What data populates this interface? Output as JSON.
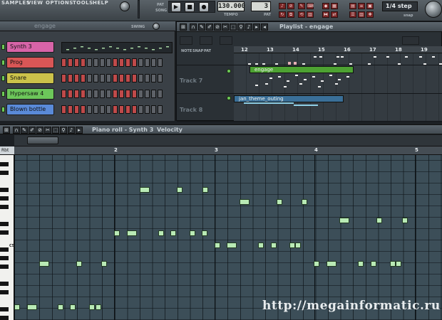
{
  "menu": [
    "SAMPLES",
    "VIEW",
    "OPTIONS",
    "TOOLS",
    "HELP"
  ],
  "toolbar": {
    "tempo": "130.000",
    "tempo_label": "TEMPO",
    "pattern_num": "3",
    "pattern_label": "PAT",
    "mode_pat": "PAT",
    "mode_song": "SONG",
    "snap": "1/4 step",
    "snap_sub": "snap",
    "icons": [
      "play-icon",
      "stop-icon",
      "record-icon"
    ]
  },
  "channel_rack": {
    "header": "engage",
    "swing_label": "SWING",
    "channels": [
      {
        "name": "Synth 3",
        "color": "#d864a8",
        "steps": null
      },
      {
        "name": "Prog",
        "color": "#d85656",
        "steps": [
          0,
          0,
          0,
          0,
          0,
          0,
          0,
          0,
          0,
          0,
          0,
          0,
          0,
          0,
          0,
          0
        ]
      },
      {
        "name": "Snare",
        "color": "#cbc24a",
        "steps": [
          0,
          0,
          0,
          0,
          0,
          0,
          0,
          0,
          0,
          0,
          0,
          0,
          0,
          0,
          0,
          0
        ]
      },
      {
        "name": "Hypersaw 4",
        "color": "#6cc65a",
        "steps": [
          0,
          0,
          0,
          0,
          0,
          0,
          0,
          0,
          0,
          0,
          0,
          0,
          0,
          0,
          0,
          0
        ]
      },
      {
        "name": "Blown bottle",
        "color": "#5a8ad8",
        "steps": [
          0,
          0,
          0,
          0,
          0,
          0,
          0,
          0,
          0,
          0,
          0,
          0,
          0,
          0,
          0,
          0
        ]
      }
    ]
  },
  "playlist": {
    "title": "Playlist - engage",
    "bars": [
      "12",
      "13",
      "14",
      "15",
      "16",
      "17",
      "18",
      "19"
    ],
    "tabs": [
      "NOTE",
      "SNAP",
      "PAT"
    ],
    "tracks": [
      {
        "name": "Track 7",
        "clip": "engage",
        "clip_color": "#4da232"
      },
      {
        "name": "Track 8",
        "clip": "jan_theme_outing",
        "clip_color": "#3a6f98"
      }
    ]
  },
  "piano_roll": {
    "title": "Piano roll - Synth 3",
    "param": "Velocity",
    "bars": [
      "2",
      "3",
      "4",
      "5"
    ],
    "c_label": "C5",
    "keyhead": "Rbt"
  },
  "watermark": "http://megainformatic.ru",
  "colors": {
    "note_fill": "#b9eab5",
    "grid_bg": "#3c4e58",
    "clip_green": "#4da232",
    "clip_blue": "#3a6f98"
  }
}
